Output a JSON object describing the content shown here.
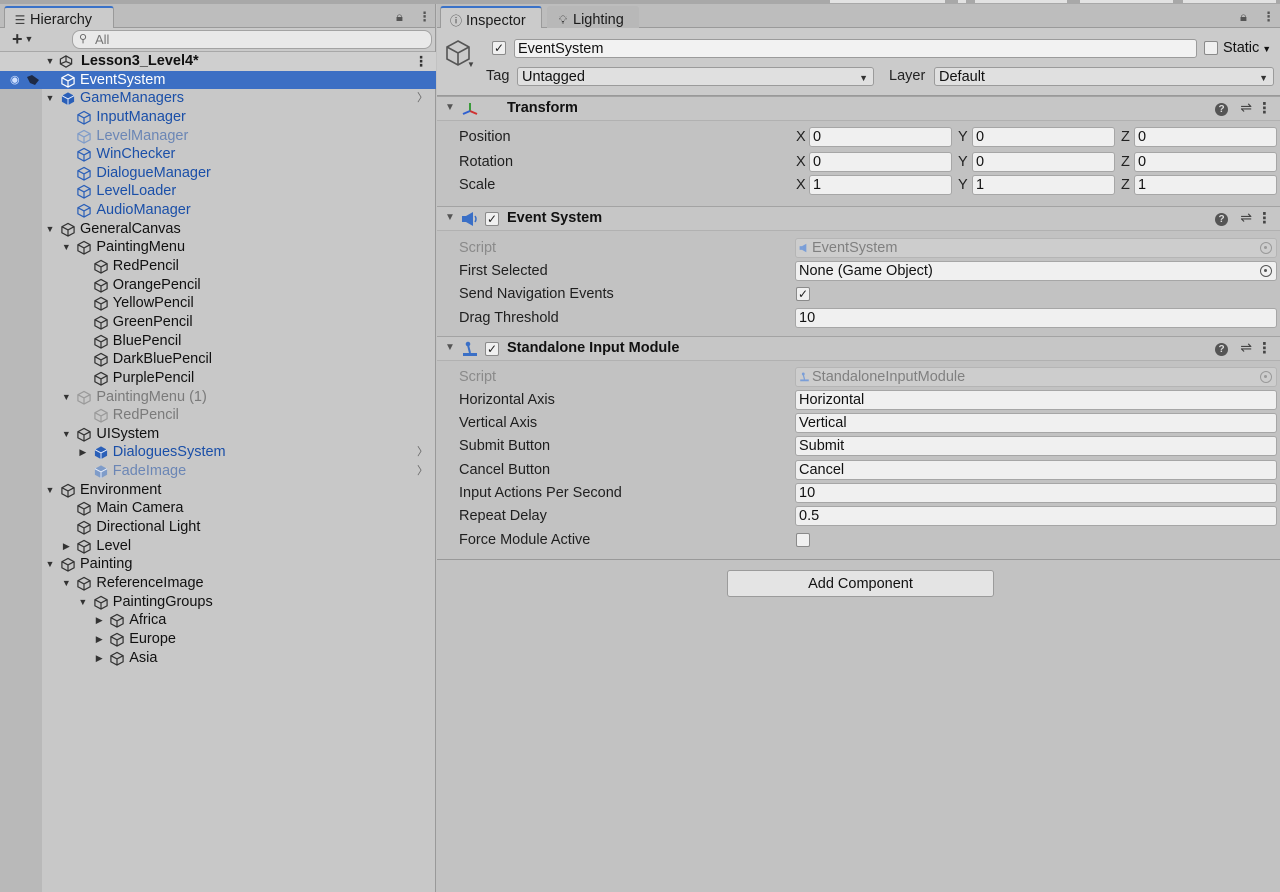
{
  "hierarchy": {
    "tab_label": "Hierarchy",
    "search_placeholder": "All",
    "scene": "Lesson3_Level4*",
    "items": [
      {
        "label": "EventSystem",
        "depth": 1,
        "arrow": "",
        "style": "normal",
        "selected": true
      },
      {
        "label": "GameManagers",
        "depth": 1,
        "arrow": "down",
        "style": "prefab",
        "prefab_root": true,
        "more": true
      },
      {
        "label": "InputManager",
        "depth": 2,
        "arrow": "",
        "style": "prefab"
      },
      {
        "label": "LevelManager",
        "depth": 2,
        "arrow": "",
        "style": "disprefab"
      },
      {
        "label": "WinChecker",
        "depth": 2,
        "arrow": "",
        "style": "prefab"
      },
      {
        "label": "DialogueManager",
        "depth": 2,
        "arrow": "",
        "style": "prefab"
      },
      {
        "label": "LevelLoader",
        "depth": 2,
        "arrow": "",
        "style": "prefab"
      },
      {
        "label": "AudioManager",
        "depth": 2,
        "arrow": "",
        "style": "prefab"
      },
      {
        "label": "GeneralCanvas",
        "depth": 1,
        "arrow": "down",
        "style": "normal"
      },
      {
        "label": "PaintingMenu",
        "depth": 2,
        "arrow": "down",
        "style": "normal"
      },
      {
        "label": "RedPencil",
        "depth": 3,
        "arrow": "",
        "style": "normal"
      },
      {
        "label": "OrangePencil",
        "depth": 3,
        "arrow": "",
        "style": "normal"
      },
      {
        "label": "YellowPencil",
        "depth": 3,
        "arrow": "",
        "style": "normal"
      },
      {
        "label": "GreenPencil",
        "depth": 3,
        "arrow": "",
        "style": "normal"
      },
      {
        "label": "BluePencil",
        "depth": 3,
        "arrow": "",
        "style": "normal"
      },
      {
        "label": "DarkBluePencil",
        "depth": 3,
        "arrow": "",
        "style": "normal"
      },
      {
        "label": "PurplePencil",
        "depth": 3,
        "arrow": "",
        "style": "normal"
      },
      {
        "label": "PaintingMenu (1)",
        "depth": 2,
        "arrow": "down",
        "style": "dis"
      },
      {
        "label": "RedPencil",
        "depth": 3,
        "arrow": "",
        "style": "dis"
      },
      {
        "label": "UISystem",
        "depth": 2,
        "arrow": "down",
        "style": "normal"
      },
      {
        "label": "DialoguesSystem",
        "depth": 3,
        "arrow": "right",
        "style": "prefab",
        "prefab_root": true,
        "more": true
      },
      {
        "label": "FadeImage",
        "depth": 3,
        "arrow": "",
        "style": "disprefab",
        "prefab_root": true,
        "more": true
      },
      {
        "label": "Environment",
        "depth": 1,
        "arrow": "down",
        "style": "normal"
      },
      {
        "label": "Main Camera",
        "depth": 2,
        "arrow": "",
        "style": "normal"
      },
      {
        "label": "Directional Light",
        "depth": 2,
        "arrow": "",
        "style": "normal"
      },
      {
        "label": "Level",
        "depth": 2,
        "arrow": "right",
        "style": "normal"
      },
      {
        "label": "Painting",
        "depth": 1,
        "arrow": "down",
        "style": "normal"
      },
      {
        "label": "ReferenceImage",
        "depth": 2,
        "arrow": "down",
        "style": "normal"
      },
      {
        "label": "PaintingGroups",
        "depth": 3,
        "arrow": "down",
        "style": "normal"
      },
      {
        "label": "Africa",
        "depth": 4,
        "arrow": "right",
        "style": "normal"
      },
      {
        "label": "Europe",
        "depth": 4,
        "arrow": "right",
        "style": "normal"
      },
      {
        "label": "Asia",
        "depth": 4,
        "arrow": "right",
        "style": "normal"
      }
    ]
  },
  "inspector": {
    "tabs": {
      "inspector": "Inspector",
      "lighting": "Lighting"
    },
    "object_name": "EventSystem",
    "static_label": "Static",
    "tag_label": "Tag",
    "tag_value": "Untagged",
    "layer_label": "Layer",
    "layer_value": "Default",
    "transform": {
      "title": "Transform",
      "position_label": "Position",
      "rotation_label": "Rotation",
      "scale_label": "Scale",
      "x": "X",
      "y": "Y",
      "z": "Z",
      "position": [
        "0",
        "0",
        "0"
      ],
      "rotation": [
        "0",
        "0",
        "0"
      ],
      "scale": [
        "1",
        "1",
        "1"
      ]
    },
    "event_system": {
      "title": "Event System",
      "script_label": "Script",
      "script_value": "EventSystem",
      "first_selected_label": "First Selected",
      "first_selected_value": "None (Game Object)",
      "send_nav_label": "Send Navigation Events",
      "send_nav_checked": true,
      "drag_threshold_label": "Drag Threshold",
      "drag_threshold_value": "10"
    },
    "standalone": {
      "title": "Standalone Input Module",
      "script_label": "Script",
      "script_value": "StandaloneInputModule",
      "horizontal_axis_label": "Horizontal Axis",
      "horizontal_axis_value": "Horizontal",
      "vertical_axis_label": "Vertical Axis",
      "vertical_axis_value": "Vertical",
      "submit_label": "Submit Button",
      "submit_value": "Submit",
      "cancel_label": "Cancel Button",
      "cancel_value": "Cancel",
      "input_actions_label": "Input Actions Per Second",
      "input_actions_value": "10",
      "repeat_delay_label": "Repeat Delay",
      "repeat_delay_value": "0.5",
      "force_label": "Force Module Active",
      "force_checked": false
    },
    "add_component": "Add Component"
  },
  "colors": {
    "selection": "#3c6fc4",
    "prefab_text": "#1a4fa8",
    "panel_bg": "#c2c2c2"
  }
}
